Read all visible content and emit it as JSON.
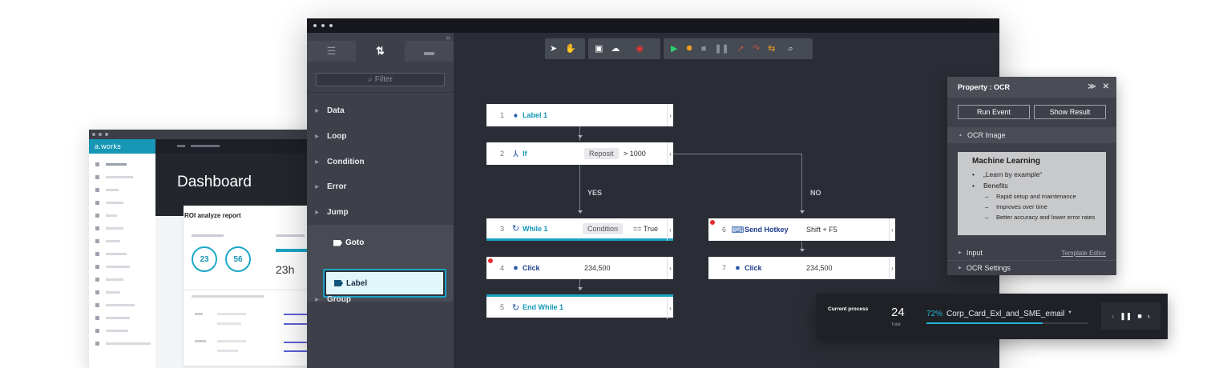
{
  "dashboard": {
    "brand": "a.works",
    "title": "Dashboard",
    "card_title": "ROI analyze report",
    "ring1": "23",
    "ring2": "56",
    "big_value": "23h"
  },
  "panel": {
    "filter_placeholder": "Filter",
    "categories": [
      "Data",
      "Loop",
      "Condition",
      "Error",
      "Jump",
      "Group"
    ],
    "jump_items": [
      "Goto",
      "Label"
    ]
  },
  "toolbar_icons": [
    "pointer-icon",
    "hand-icon",
    "save-icon",
    "cloud-upload-icon",
    "record-icon",
    "play-icon",
    "debug-icon",
    "stop-icon",
    "pause-icon",
    "step-into-icon",
    "step-over-icon",
    "step-out-icon",
    "search-icon"
  ],
  "flow": {
    "nodes": [
      {
        "num": "1",
        "name": "Label 1",
        "icon": "tag-icon"
      },
      {
        "num": "2",
        "name": "If",
        "pill": "Reposit",
        "value": "> 1000",
        "icon": "branch-icon"
      },
      {
        "num": "3",
        "name": "While 1",
        "pill": "Condition",
        "value": "== True",
        "icon": "loop-icon"
      },
      {
        "num": "4",
        "name": "Click",
        "value": "234,500",
        "icon": "mouse-icon"
      },
      {
        "num": "5",
        "name": "End While 1",
        "icon": "loop-icon"
      },
      {
        "num": "6",
        "name": "Send Hotkey",
        "value": "Shift + F5",
        "icon": "keyboard-icon"
      },
      {
        "num": "7",
        "name": "Click",
        "value": "234,500",
        "icon": "mouse-icon"
      }
    ],
    "yes_label": "YES",
    "no_label": "NO"
  },
  "property": {
    "title": "Property : OCR",
    "run_event": "Run Event",
    "show_result": "Show Result",
    "ocr_image": "OCR Image",
    "ocr_heading": "Machine Learning",
    "ocr_bullets": [
      "„Learn by example“",
      "Benefits"
    ],
    "ocr_subbullets": [
      "Rapid setup and maintenance",
      "Improves over time",
      "Better accuracy and lower error rates"
    ],
    "input": "Input",
    "template_editor": "Template Editor",
    "ocr_settings": "OCR Settings"
  },
  "process": {
    "label": "Current process",
    "count": "24",
    "total_label": "Total",
    "percent": "72%",
    "percent_value": 0.72,
    "name": "Corp_Card_Exl_and_SME_email"
  },
  "colors": {
    "accent": "#1aa4c5",
    "canvas": "#2a2d35",
    "panel": "#3d4049"
  }
}
